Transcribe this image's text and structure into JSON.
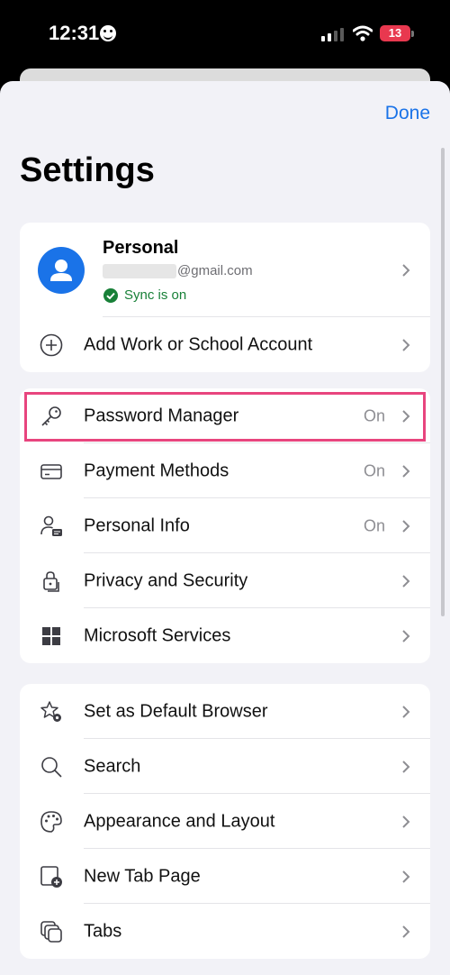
{
  "status_bar": {
    "time": "12:31",
    "battery": "13",
    "icons": [
      "face-icon",
      "signal-icon",
      "wifi-icon",
      "battery-icon"
    ]
  },
  "header": {
    "done_label": "Done",
    "title": "Settings"
  },
  "account": {
    "name": "Personal",
    "email_suffix": "@gmail.com",
    "sync_status": "Sync is on",
    "add_account_label": "Add Work or School Account"
  },
  "group_main": [
    {
      "label": "Password Manager",
      "value": "On",
      "icon": "key-icon"
    },
    {
      "label": "Payment Methods",
      "value": "On",
      "icon": "card-icon"
    },
    {
      "label": "Personal Info",
      "value": "On",
      "icon": "person-info-icon"
    },
    {
      "label": "Privacy and Security",
      "value": "",
      "icon": "lock-icon"
    },
    {
      "label": "Microsoft Services",
      "value": "",
      "icon": "grid-icon"
    }
  ],
  "group_browser": [
    {
      "label": "Set as Default Browser",
      "icon": "star-gear-icon"
    },
    {
      "label": "Search",
      "icon": "search-icon"
    },
    {
      "label": "Appearance and Layout",
      "icon": "palette-icon"
    },
    {
      "label": "New Tab Page",
      "icon": "new-tab-icon"
    },
    {
      "label": "Tabs",
      "icon": "tabs-icon"
    }
  ],
  "colors": {
    "accent": "#1a73e8",
    "sync_green": "#188038",
    "highlight": "#e8457e",
    "battery": "#e8384f"
  }
}
